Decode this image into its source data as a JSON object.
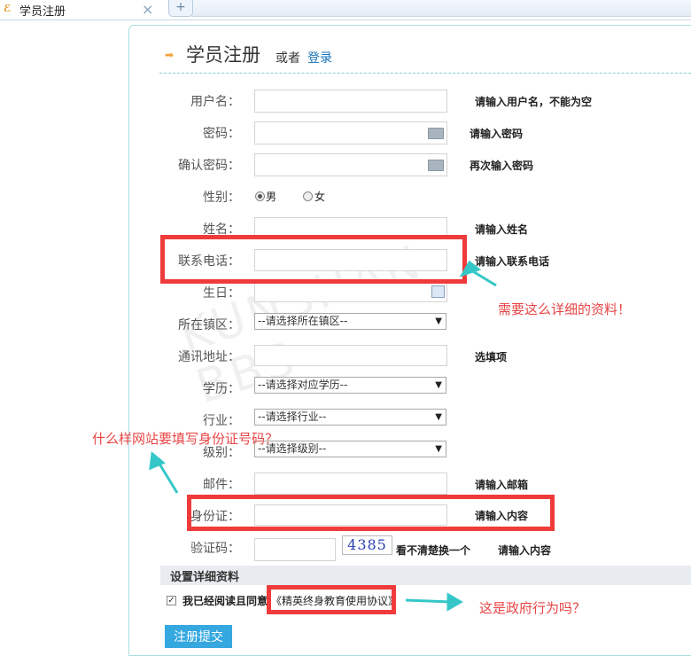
{
  "tab": {
    "title": "学员注册",
    "icon": "app-logo-icon",
    "close_label": "×",
    "add_label": "+"
  },
  "header": {
    "title": "学员注册",
    "or_text": "或者",
    "login_link": "登录"
  },
  "form": {
    "username": {
      "label": "用户名：",
      "value": "",
      "hint": "请输入用户名，不能为空"
    },
    "password": {
      "label": "密码：",
      "value": "",
      "hint": "请输入密码"
    },
    "confirm_password": {
      "label": "确认密码：",
      "value": "",
      "hint": "再次输入密码"
    },
    "gender": {
      "label": "性别：",
      "options": [
        "男",
        "女"
      ],
      "selected": "男"
    },
    "name": {
      "label": "姓名：",
      "value": "",
      "hint": "请输入姓名"
    },
    "phone": {
      "label": "联系电话：",
      "value": "",
      "hint": "请输入联系电话"
    },
    "birthday": {
      "label": "生日：",
      "value": ""
    },
    "town": {
      "label": "所在镇区：",
      "selected": "--请选择所在镇区--"
    },
    "address": {
      "label": "通讯地址：",
      "value": "",
      "hint": "选填项"
    },
    "education": {
      "label": "学历：",
      "selected": "--请选择对应学历--"
    },
    "industry": {
      "label": "行业：",
      "selected": "--请选择行业--"
    },
    "level": {
      "label": "级别：",
      "selected": "--请选择级别--"
    },
    "email": {
      "label": "邮件：",
      "value": "",
      "hint": "请输入邮箱"
    },
    "id_card": {
      "label": "身份证：",
      "value": "",
      "hint": "请输入内容"
    },
    "captcha": {
      "label": "验证码：",
      "value": "",
      "image_text": "4385",
      "refresh_text": "看不清楚换一个",
      "hint": "请输入内容"
    }
  },
  "section": {
    "title": "设置详细资料"
  },
  "agreement": {
    "checked": true,
    "text": "我已经阅读且同意",
    "link": "《精英终身教育使用协议》"
  },
  "submit_label": "注册提交",
  "annotations": {
    "note_detail": "需要这么详细的资料！",
    "note_idcard": "什么样网站要填写身份证号码？",
    "note_gov": "这是政府行为吗？"
  },
  "watermark": "KUNSHAN BBS",
  "colors": {
    "accent": "#1873b8",
    "submit_bg": "#35a8e0",
    "annotation_red": "#ef3b3b",
    "arrow_teal": "#35c7c7"
  }
}
